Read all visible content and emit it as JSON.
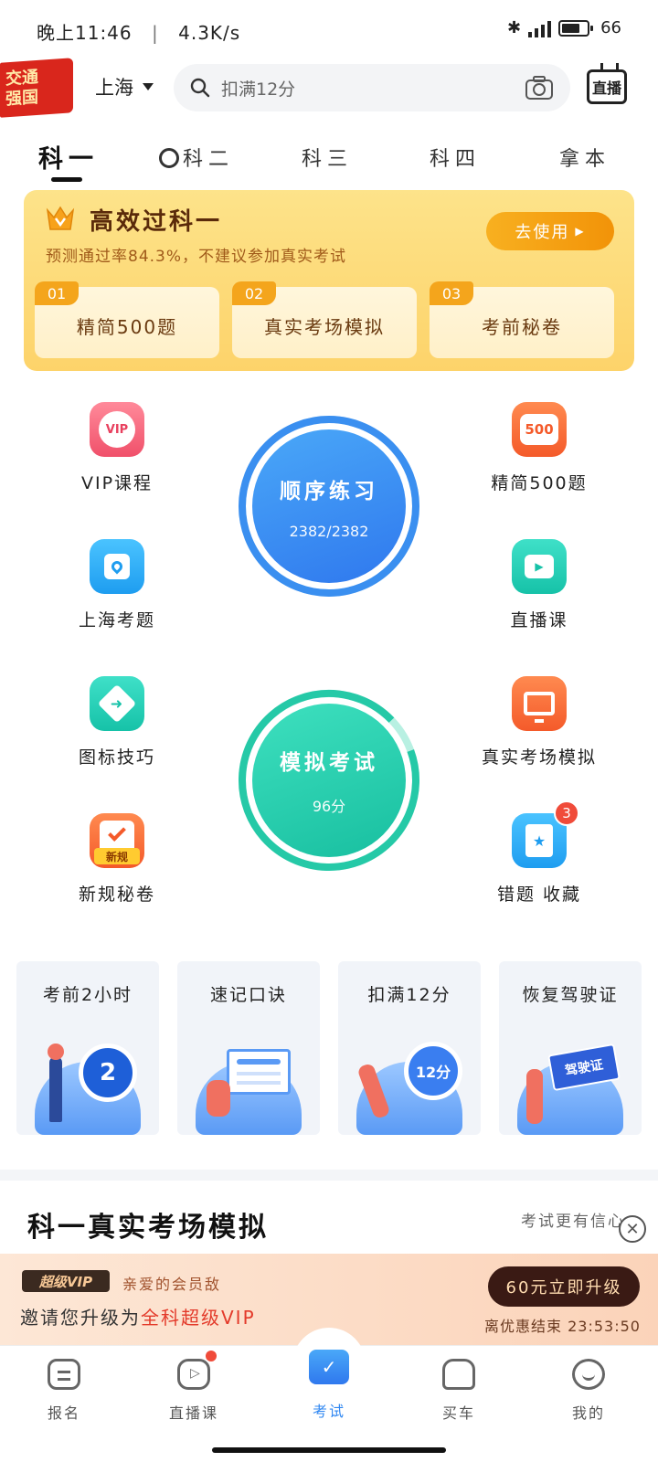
{
  "status_bar": {
    "time": "晚上11:46",
    "network_speed": "4.3K/s",
    "battery": "66"
  },
  "header": {
    "logo_text": "交通强国",
    "city": "上海",
    "search_placeholder": "扣满12分",
    "live_label": "直播"
  },
  "tabs": [
    {
      "label": "科一",
      "active": true
    },
    {
      "label": "科二",
      "active": false
    },
    {
      "label": "科三",
      "active": false
    },
    {
      "label": "科四",
      "active": false
    },
    {
      "label": "拿本",
      "active": false
    }
  ],
  "promo": {
    "title": "高效过科一",
    "subtitle": "预测通过率84.3%，不建议参加真实考试",
    "button": "去使用",
    "items": [
      {
        "num": "01",
        "label": "精简500题"
      },
      {
        "num": "02",
        "label": "真实考场模拟"
      },
      {
        "num": "03",
        "label": "考前秘卷"
      }
    ]
  },
  "grid": {
    "vip": {
      "label": "VIP课程",
      "icon_text": "VIP"
    },
    "simplified": {
      "label": "精简500题",
      "icon_text": "500"
    },
    "local": {
      "label": "上海考题"
    },
    "live": {
      "label": "直播课"
    },
    "signs": {
      "label": "图标技巧"
    },
    "real_exam": {
      "label": "真实考场模拟"
    },
    "new_rules": {
      "label": "新规秘卷",
      "icon_text": "新规"
    },
    "wrong": {
      "label": "错题 收藏",
      "badge": "3"
    }
  },
  "practice": {
    "title": "顺序练习",
    "progress": "2382/2382"
  },
  "mock": {
    "title": "模拟考试",
    "score": "96分"
  },
  "tools": [
    {
      "label": "考前2小时",
      "icon_text": "2"
    },
    {
      "label": "速记口诀"
    },
    {
      "label": "扣满12分",
      "icon_text": "12分"
    },
    {
      "label": "恢复驾驶证",
      "icon_text": "驾驶证"
    }
  ],
  "section": {
    "title": "科一真实考场模拟",
    "more": "考试更有信心"
  },
  "vip_banner": {
    "badge": "超级VIP",
    "line1": "亲爱的会员敌",
    "line2_prefix": "邀请您升级为",
    "line2_highlight": "全科超级VIP",
    "button": "60元立即升级",
    "countdown": "离优惠结束 23:53:50"
  },
  "bottom_nav": [
    {
      "label": "报名"
    },
    {
      "label": "直播课"
    },
    {
      "label": "考试",
      "active": true
    },
    {
      "label": "买车"
    },
    {
      "label": "我的"
    }
  ],
  "colors": {
    "accent": "#2f87f2",
    "practice_blue": "#3a8ff0",
    "mock_green": "#25c9a7",
    "promo_yellow": "#fdd36a"
  }
}
